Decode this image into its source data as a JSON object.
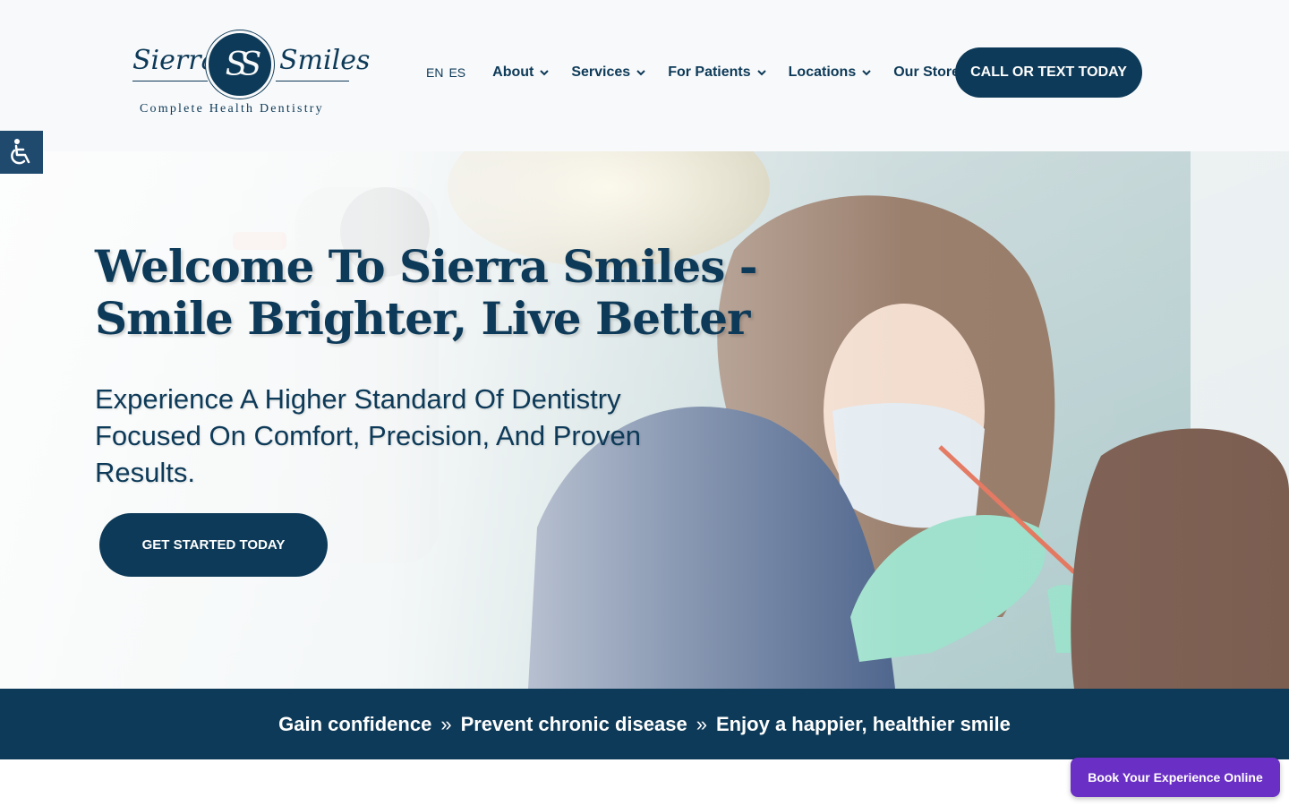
{
  "header": {
    "logo": {
      "script_left": "Sierra",
      "monogram": "SS",
      "script_right": "Smiles",
      "tagline": "Complete Health Dentistry"
    },
    "lang": [
      "EN",
      "ES"
    ],
    "nav": [
      {
        "label": "About",
        "has_dropdown": true
      },
      {
        "label": "Services",
        "has_dropdown": true
      },
      {
        "label": "For Patients",
        "has_dropdown": true
      },
      {
        "label": "Locations",
        "has_dropdown": true
      },
      {
        "label": "Our Store",
        "has_dropdown": false
      }
    ],
    "cta": "CALL OR TEXT TODAY"
  },
  "accessibility": {
    "icon": "wheelchair-icon"
  },
  "hero": {
    "title_line1": "Welcome To Sierra Smiles -",
    "title_line2": "Smile Brighter, Live Better",
    "subtitle": "Experience A Higher Standard Of Dentistry Focused On Comfort, Precision, And Proven Results.",
    "cta": "GET STARTED TODAY"
  },
  "banner": {
    "items": [
      "Gain confidence",
      "Prevent chronic disease",
      "Enjoy a happier, healthier smile"
    ],
    "separator": "»"
  },
  "book_online": "Book Your Experience Online",
  "colors": {
    "brand_navy": "#0d3a58",
    "book_purple": "#6a2fc4",
    "header_bg": "#f8f9fa"
  }
}
